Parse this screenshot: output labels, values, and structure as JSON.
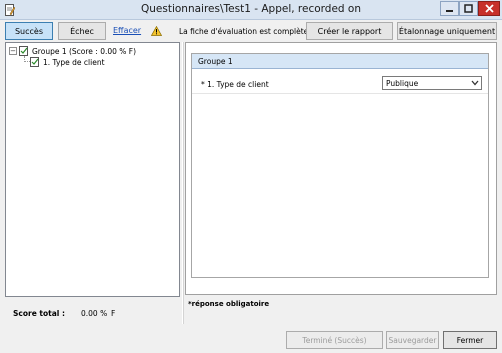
{
  "window": {
    "title": "Questionnaires\\Test1 - Appel,  recorded on"
  },
  "toolbar": {
    "success_label": "Succès",
    "failure_label": "Échec",
    "clear_link": "Effacer",
    "status_text": "La fiche d'évaluation est complète.",
    "report_label": "Créer le rapport",
    "calibration_label": "Étalonnage uniquement"
  },
  "tree": {
    "group_label": "Groupe 1  (Score : 0.00 % F)",
    "question_label": "1. Type de client"
  },
  "score": {
    "label": "Score total :",
    "value": "0.00 %",
    "grade": "F"
  },
  "form": {
    "group_title": "Groupe 1",
    "question_label": "* 1.  Type de client",
    "answer_value": "Publique",
    "required_note": "*réponse obligatoire"
  },
  "footer": {
    "done_label": "Terminé (Succès)",
    "save_label": "Sauvegarder",
    "close_label": "Fermer"
  },
  "colors": {
    "titlebar": "#d9e4f1",
    "close_red": "#c7302a",
    "selected_button": "#c7e2f8",
    "group_header": "#d6e6f6",
    "link": "#1a4fb6"
  }
}
